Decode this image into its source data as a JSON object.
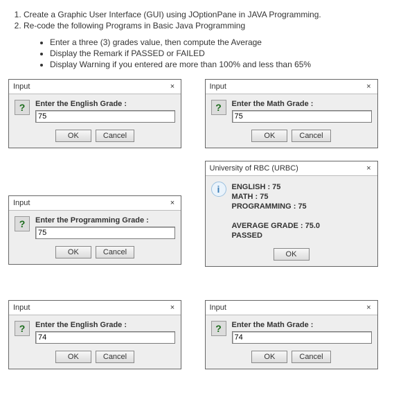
{
  "instructions": {
    "items": [
      "Create a Graphic User Interface (GUI) using JOptionPane in JAVA Programming.",
      "Re-code the following Programs in Basic Java Programming"
    ],
    "sub": [
      "Enter a three (3) grades value, then compute the Average",
      "Display the Remark if PASSED or FAILED",
      "Display Warning if you entered are more than 100% and less than 65%"
    ]
  },
  "dialog1": {
    "title": "Input",
    "prompt": "Enter the English Grade :",
    "value": "75",
    "ok": "OK",
    "cancel": "Cancel"
  },
  "dialog2": {
    "title": "Input",
    "prompt": "Enter the Math Grade :",
    "value": "75",
    "ok": "OK",
    "cancel": "Cancel"
  },
  "dialog3": {
    "title": "Input",
    "prompt": "Enter the Programming Grade :",
    "value": "75",
    "ok": "OK",
    "cancel": "Cancel"
  },
  "dialog4": {
    "title": "University of RBC (URBC)",
    "lines": [
      "ENGLISH : 75",
      "MATH : 75",
      "PROGRAMMING : 75",
      "",
      "AVERAGE GRADE : 75.0",
      "PASSED"
    ],
    "ok": "OK"
  },
  "dialog5": {
    "title": "Input",
    "prompt": "Enter the English Grade :",
    "value": "74",
    "ok": "OK",
    "cancel": "Cancel"
  },
  "dialog6": {
    "title": "Input",
    "prompt": "Enter the Math Grade :",
    "value": "74",
    "ok": "OK",
    "cancel": "Cancel"
  },
  "icons": {
    "question": "?",
    "info": "i",
    "close": "×"
  }
}
